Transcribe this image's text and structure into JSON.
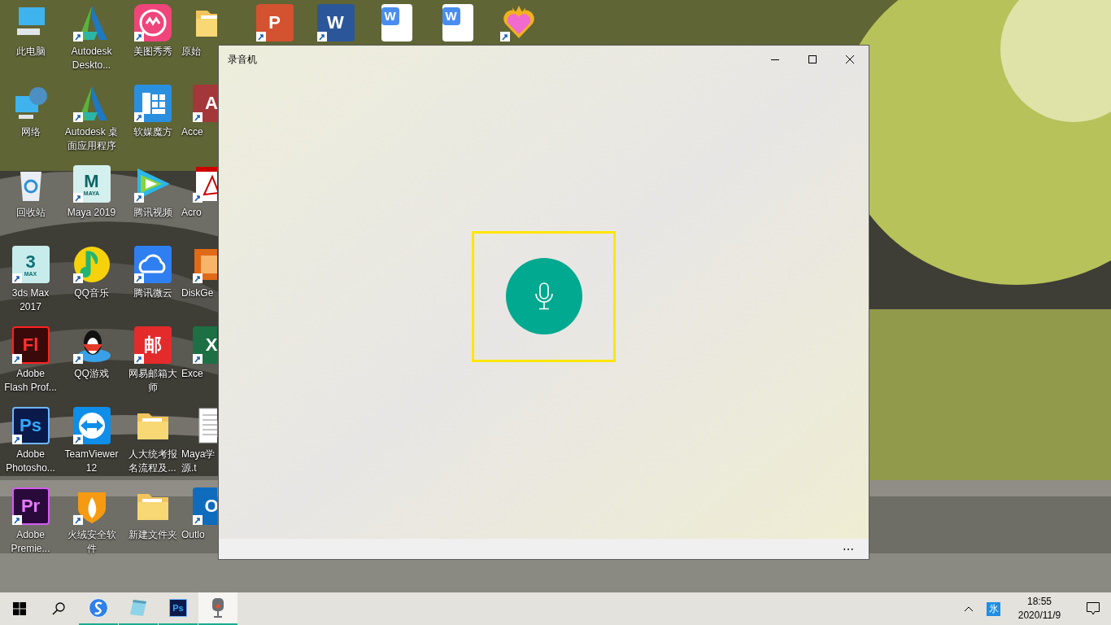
{
  "desktop_columns": [
    [
      {
        "label": "此电脑",
        "kind": "computer",
        "shortcut": false
      },
      {
        "label": "网络",
        "kind": "network",
        "shortcut": false
      },
      {
        "label": "回收站",
        "kind": "recycle",
        "shortcut": false
      },
      {
        "label": "3ds Max\n2017",
        "kind": "max",
        "glyph": "3",
        "sub": "MAX",
        "shortcut": true
      },
      {
        "label": "Adobe\nFlash Prof...",
        "kind": "flash",
        "glyph": "Fl",
        "shortcut": true
      },
      {
        "label": "Adobe\nPhotosho...",
        "kind": "ps",
        "glyph": "Ps",
        "shortcut": true
      },
      {
        "label": "Adobe\nPremie...",
        "kind": "pr",
        "glyph": "Pr",
        "shortcut": true
      }
    ],
    [
      {
        "label": "Autodesk\nDeskto...",
        "kind": "autodesk",
        "shortcut": true
      },
      {
        "label": "Autodesk 桌面应用程序",
        "kind": "autodesk",
        "shortcut": true
      },
      {
        "label": "Maya 2019",
        "kind": "maya",
        "glyph": "M",
        "sub": "MAYA",
        "shortcut": true
      },
      {
        "label": "QQ音乐",
        "kind": "qqmusic",
        "shortcut": true
      },
      {
        "label": "QQ游戏",
        "kind": "qqgame",
        "shortcut": true
      },
      {
        "label": "TeamViewer\n12",
        "kind": "teamviewer",
        "shortcut": true
      },
      {
        "label": "火绒安全软件",
        "kind": "huorong",
        "shortcut": true
      }
    ],
    [
      {
        "label": "美图秀秀",
        "kind": "meitu",
        "shortcut": true
      },
      {
        "label": "软媒魔方",
        "kind": "cube",
        "shortcut": true
      },
      {
        "label": "腾讯视频",
        "kind": "video",
        "shortcut": true
      },
      {
        "label": "腾讯微云",
        "kind": "cloud",
        "shortcut": true
      },
      {
        "label": "网易邮箱大师",
        "kind": "mail",
        "glyph": "邮",
        "shortcut": true
      },
      {
        "label": "人大统考报名流程及...",
        "kind": "folder",
        "shortcut": false
      },
      {
        "label": "新建文件夹",
        "kind": "folder",
        "shortcut": false
      }
    ],
    [
      {
        "label": "原始",
        "kind": "folder",
        "shortcut": false
      },
      {
        "label": "Acce",
        "kind": "access",
        "glyph": "A",
        "shortcut": true
      },
      {
        "label": "Acro",
        "kind": "acrobat",
        "shortcut": true
      },
      {
        "label": "DiskGe",
        "kind": "disk",
        "shortcut": true
      },
      {
        "label": "Exce",
        "kind": "excel",
        "glyph": "X",
        "shortcut": true
      },
      {
        "label": "Maya学源.t",
        "kind": "textfile",
        "shortcut": false
      },
      {
        "label": "Outlo",
        "kind": "outlook",
        "glyph": "O",
        "shortcut": true
      }
    ],
    [
      {
        "kind": "ppt",
        "glyph": "P",
        "shortcut": true
      }
    ],
    [
      {
        "kind": "word",
        "glyph": "W",
        "shortcut": true
      }
    ],
    [
      {
        "kind": "wps",
        "glyph": "W",
        "shortcut": false
      }
    ],
    [
      {
        "kind": "wps",
        "glyph": "W",
        "shortcut": false
      }
    ],
    [
      {
        "kind": "heart",
        "shortcut": true
      }
    ]
  ],
  "window": {
    "title": "录音机",
    "more": "⋯",
    "highlighted": true
  },
  "taskbar": {
    "apps": [
      {
        "kind": "sogou",
        "selected": false,
        "running": true
      },
      {
        "kind": "notepad",
        "selected": false,
        "running": true
      },
      {
        "kind": "ps",
        "glyph": "Ps",
        "selected": false,
        "running": true
      },
      {
        "kind": "recorder",
        "selected": true,
        "running": true
      }
    ],
    "ime": "氷",
    "time": "18:55",
    "date": "2020/11/9"
  }
}
